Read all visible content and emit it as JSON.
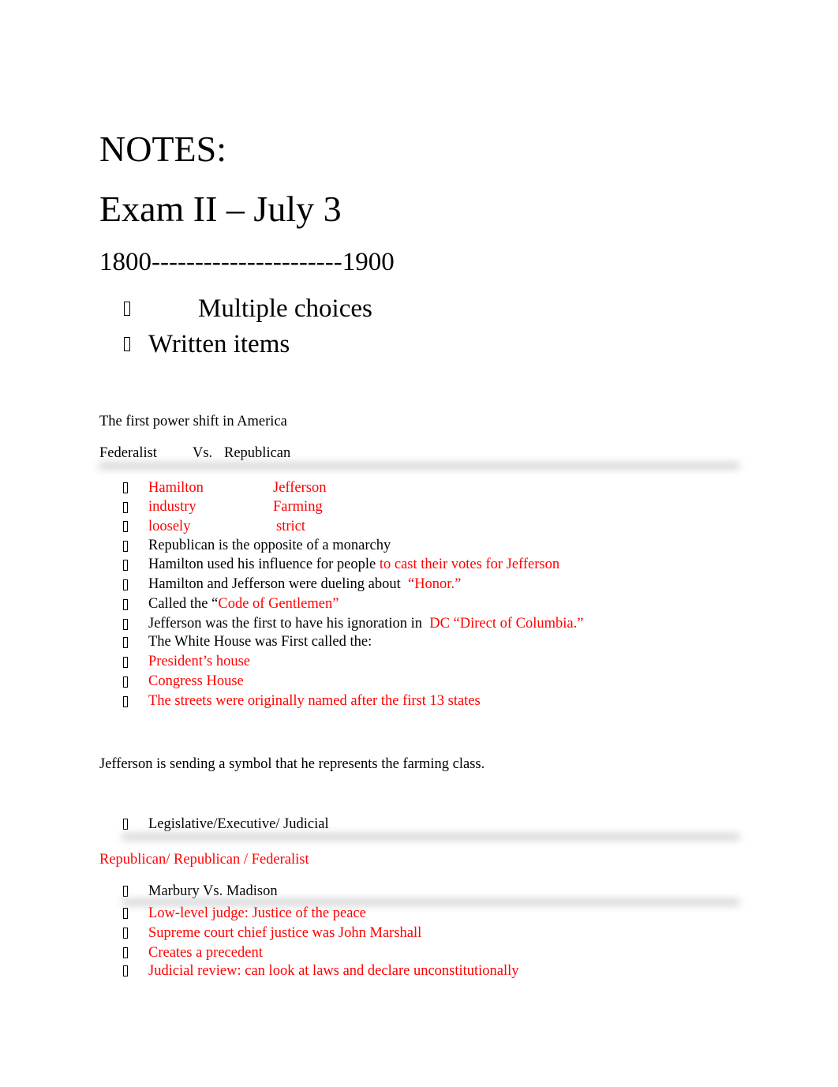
{
  "heading": {
    "title": "NOTES:",
    "subtitle": "Exam II – July 3",
    "timeline": "1800----------------------1900"
  },
  "exam_format": [
    "Multiple choices",
    "Written items"
  ],
  "section1": {
    "intro": "The first power shift in America",
    "versus": {
      "left": "Federalist",
      "mid": "Vs.",
      "right": "Republican"
    },
    "comparison": [
      {
        "left": "Hamilton",
        "right": "Jefferson"
      },
      {
        "left": "industry",
        "right": "Farming"
      },
      {
        "left": "loosely",
        "right": "strict"
      }
    ],
    "items": [
      {
        "black": "Republican is the opposite of a monarchy",
        "red": ""
      },
      {
        "black": "Hamilton used his influence for people ",
        "red": "to cast their votes for Jefferson"
      },
      {
        "black": "Hamilton and Jefferson were dueling about  ",
        "red": "“Honor.”"
      },
      {
        "black": "Called the “",
        "red": "Code of Gentlemen”"
      },
      {
        "black": "Jefferson was the first to have his ignoration in  ",
        "red": "DC “Direct of Columbia.”"
      },
      {
        "black": "The White House was First called the:",
        "red": ""
      },
      {
        "black": "",
        "red": "President’s house"
      },
      {
        "black": "",
        "red": "Congress House"
      },
      {
        "black": "",
        "red": "The streets were originally named after the first 13 states"
      }
    ]
  },
  "section2": {
    "statement": "Jefferson is sending a symbol that he represents the farming class.",
    "branches": "Legislative/Executive/ Judicial",
    "branches_answer": "Republican/ Republican / Federalist"
  },
  "section3": {
    "case": "Marbury Vs. Madison",
    "items": [
      "Low-level judge: Justice of the peace",
      "Supreme court chief justice was John Marshall",
      "Creates a precedent",
      "Judicial review: can look at laws and declare unconstitutionally"
    ]
  },
  "colors": {
    "text": "#000000",
    "answer": "#ff0000"
  }
}
